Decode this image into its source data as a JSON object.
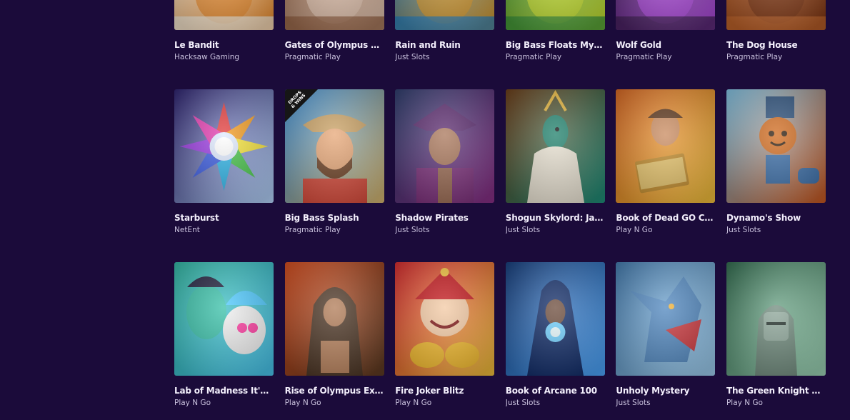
{
  "games": [
    {
      "title": "Le Bandit",
      "provider": "Hacksaw Gaming",
      "icon": "bandit-icon",
      "colors": [
        "#f5f1e6",
        "#e98a2a"
      ]
    },
    {
      "title": "Gates of Olympus Roul...",
      "provider": "Pragmatic Play",
      "icon": "roulette-icon",
      "colors": [
        "#8f5a3a",
        "#e3c6b2"
      ]
    },
    {
      "title": "Rain and Ruin",
      "provider": "Just Slots",
      "icon": "rain-ruin-icon",
      "colors": [
        "#1d7dc6",
        "#d89a2c"
      ]
    },
    {
      "title": "Big Bass Floats My Boat",
      "provider": "Pragmatic Play",
      "icon": "bass-boat-icon",
      "colors": [
        "#2f8b3a",
        "#c9e12f"
      ]
    },
    {
      "title": "Wolf Gold",
      "provider": "Pragmatic Play",
      "icon": "wolf-gold-icon",
      "colors": [
        "#3a1d4f",
        "#b04be0"
      ]
    },
    {
      "title": "The Dog House",
      "provider": "Pragmatic Play",
      "icon": "dog-house-icon",
      "colors": [
        "#c86a2e",
        "#7c3513"
      ]
    },
    {
      "title": "Starburst",
      "provider": "NetEnt",
      "icon": "starburst-icon",
      "colors": [
        "#2a1f6e",
        "#b8d8ff"
      ]
    },
    {
      "title": "Big Bass Splash",
      "provider": "Pragmatic Play",
      "icon": "fisherman-icon",
      "colors": [
        "#3b8fd9",
        "#d9b76e"
      ],
      "badge": "DROPS & WINS"
    },
    {
      "title": "Shadow Pirates",
      "provider": "Just Slots",
      "icon": "pirate-icon",
      "colors": [
        "#2a3a6b",
        "#8a2f86"
      ]
    },
    {
      "title": "Shogun Skylord: Jade ...",
      "provider": "Just Slots",
      "icon": "peacock-icon",
      "colors": [
        "#6a3a14",
        "#1e8f7a"
      ]
    },
    {
      "title": "Book of Dead GO Collect",
      "provider": "Play N Go",
      "icon": "explorer-book-icon",
      "colors": [
        "#d7641e",
        "#f3c23d"
      ]
    },
    {
      "title": "Dynamo's Show",
      "provider": "Just Slots",
      "icon": "robot-icon",
      "colors": [
        "#7fc3e6",
        "#c8571e"
      ]
    },
    {
      "title": "Lab of Madness It's A-...",
      "provider": "Play N Go",
      "icon": "mad-scientist-icon",
      "colors": [
        "#2fb7a3",
        "#4ac6f0"
      ]
    },
    {
      "title": "Rise of Olympus Extreme",
      "provider": "Play N Go",
      "icon": "hooded-warrior-icon",
      "colors": [
        "#d64a1a",
        "#5a3a22"
      ]
    },
    {
      "title": "Fire Joker Blitz",
      "provider": "Play N Go",
      "icon": "joker-icon",
      "colors": [
        "#d8272b",
        "#f2c23c"
      ]
    },
    {
      "title": "Book of Arcane 100",
      "provider": "Just Slots",
      "icon": "wizard-orb-icon",
      "colors": [
        "#123a7a",
        "#4ea8ff"
      ]
    },
    {
      "title": "Unholy Mystery",
      "provider": "Just Slots",
      "icon": "werewolf-icon",
      "colors": [
        "#3f78ad",
        "#9fcff0"
      ]
    },
    {
      "title": "The Green Knight Oath...",
      "provider": "Play N Go",
      "icon": "green-knight-icon",
      "colors": [
        "#2e6a4c",
        "#9fd6b8"
      ]
    }
  ]
}
